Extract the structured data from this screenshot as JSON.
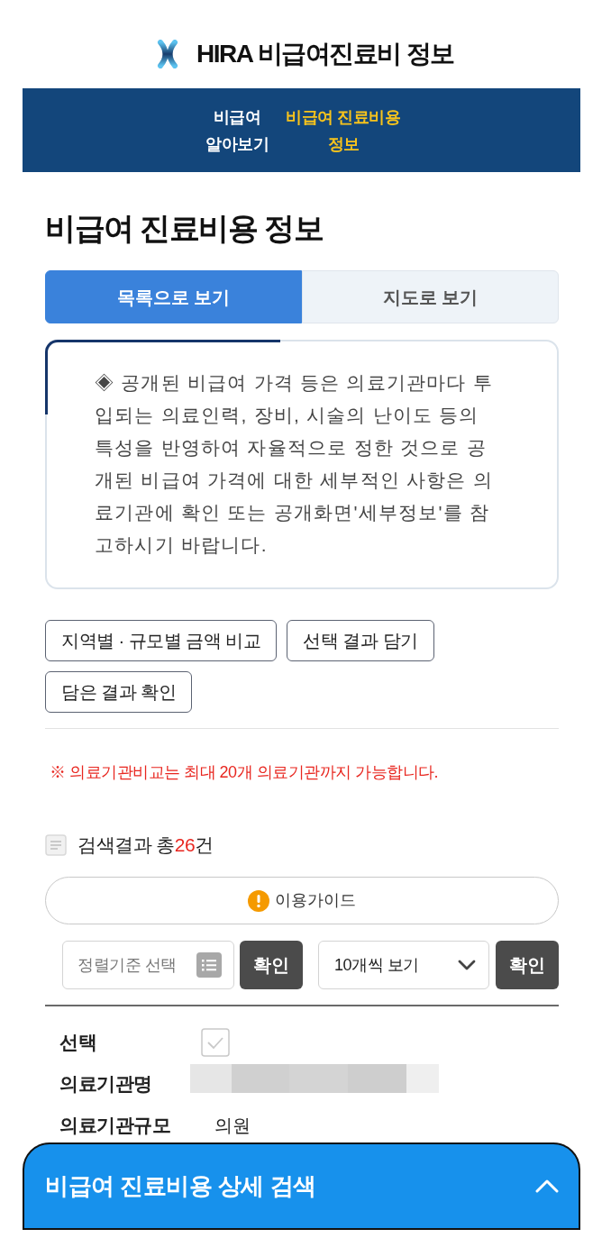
{
  "header": {
    "title": "HIRA 비급여진료비 정보"
  },
  "nav": [
    {
      "label": "비급여 알아보기",
      "selected": false
    },
    {
      "label": "비급여 진료비용 정보",
      "selected": true
    }
  ],
  "page_title": "비급여 진료비용 정보",
  "tabs": [
    {
      "label": "목록으로 보기",
      "selected": true
    },
    {
      "label": "지도로 보기",
      "selected": false
    }
  ],
  "notice": {
    "text": "◈ 공개된 비급여 가격 등은 의료기관마다 투입되는 의료인력, 장비, 시술의 난이도 등의 특성을 반영하여 자율적으로 정한 것으로 공개된 비급여 가격에 대한 세부적인 사항은 의료기관에 확인 또는 공개화면'세부정보'를 참고하시기 바랍니다."
  },
  "action_buttons": [
    {
      "label": "지역별 · 규모별 금액 비교"
    },
    {
      "label": "선택 결과 담기"
    },
    {
      "label": "담은 결과 확인"
    }
  ],
  "limit_notice": "※ 의료기관비교는 최대 20개 의료기관까지 가능합니다.",
  "results": {
    "label": "검색결과 총",
    "count": "26",
    "unit": "건"
  },
  "guide_button": {
    "label": "이용가이드"
  },
  "sort": {
    "placeholder": "정렬기준 선택",
    "confirm": "확인"
  },
  "page_size": {
    "value": "10개씩 보기",
    "confirm": "확인"
  },
  "record": [
    {
      "kind": "checkbox",
      "label": "선택",
      "checked": false
    },
    {
      "kind": "redacted",
      "label": "의료기관명"
    },
    {
      "kind": "text",
      "label": "의료기관규모",
      "value": "의원"
    }
  ],
  "detail_search": {
    "title": "비급여 진료비용 상세 검색",
    "expanded": false
  }
}
